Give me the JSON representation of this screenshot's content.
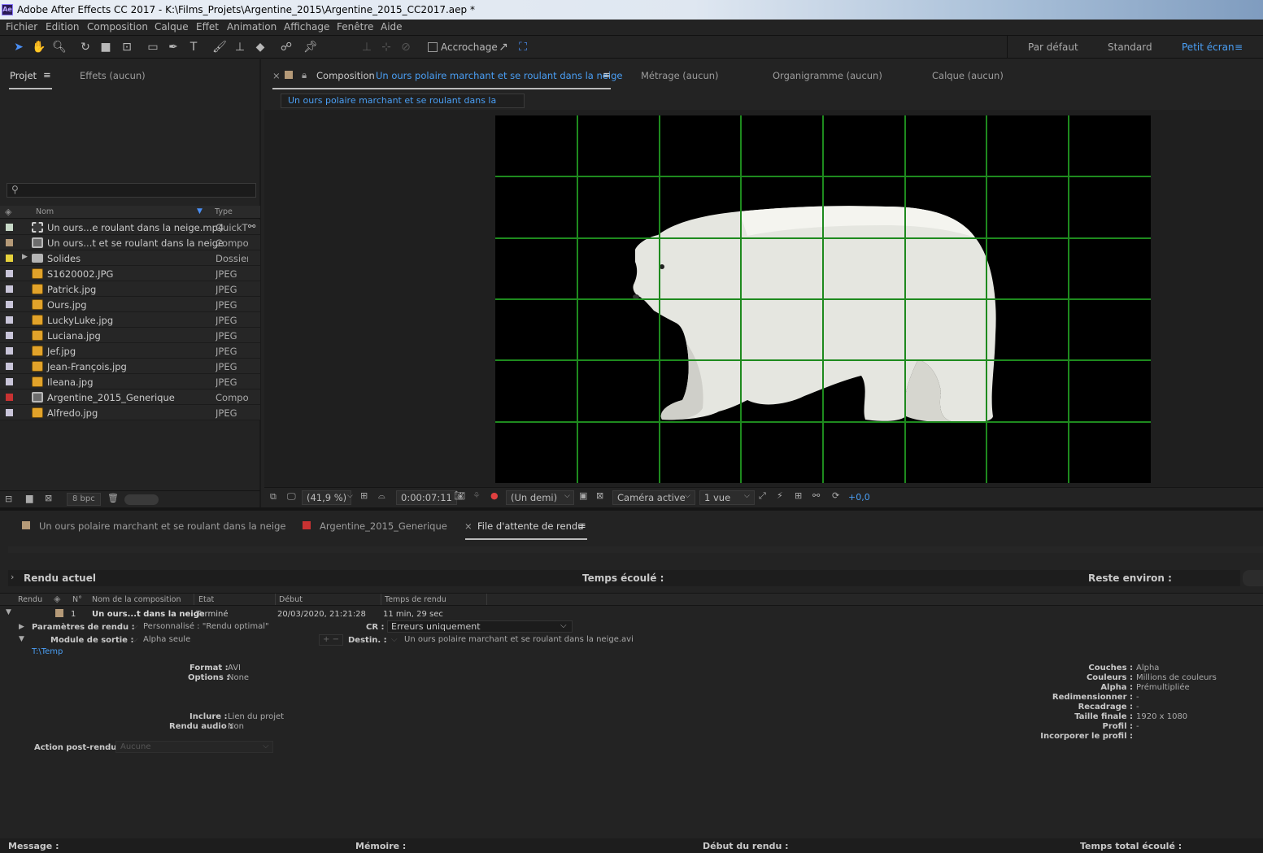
{
  "window": {
    "title": "Adobe After Effects CC 2017 - K:\\Films_Projets\\Argentine_2015\\Argentine_2015_CC2017.aep *",
    "app_icon": "Ae"
  },
  "menu": [
    "Fichier",
    "Edition",
    "Composition",
    "Calque",
    "Effet",
    "Animation",
    "Affichage",
    "Fenêtre",
    "Aide"
  ],
  "toolbar": {
    "snap_label": "Accrochage"
  },
  "workspaces": [
    "Par défaut",
    "Standard",
    "Petit écran"
  ],
  "project_panel": {
    "tabs": [
      "Projet",
      "Effets (aucun)"
    ],
    "search_placeholder": "",
    "col_name": "Nom",
    "col_type": "Type",
    "items": [
      {
        "name": "Un ours...e roulant dans la neige.mp4",
        "type": "QuickTi",
        "color": "#c8d9c8",
        "icon": "footage-icon"
      },
      {
        "name": "Un ours...t et se roulant dans la neige",
        "type": "Compo",
        "color": "#b59a78",
        "icon": "composition-icon"
      },
      {
        "name": "Solides",
        "type": "Dossier",
        "color": "#e6d23c",
        "icon": "folder-icon"
      },
      {
        "name": "S1620002.JPG",
        "type": "JPEG",
        "color": "#c9c5d9",
        "icon": "image-icon"
      },
      {
        "name": "Patrick.jpg",
        "type": "JPEG",
        "color": "#c9c5d9",
        "icon": "image-icon"
      },
      {
        "name": "Ours.jpg",
        "type": "JPEG",
        "color": "#c9c5d9",
        "icon": "image-icon"
      },
      {
        "name": "LuckyLuke.jpg",
        "type": "JPEG",
        "color": "#c9c5d9",
        "icon": "image-icon"
      },
      {
        "name": "Luciana.jpg",
        "type": "JPEG",
        "color": "#c9c5d9",
        "icon": "image-icon"
      },
      {
        "name": "Jef.jpg",
        "type": "JPEG",
        "color": "#c9c5d9",
        "icon": "image-icon"
      },
      {
        "name": "Jean-François.jpg",
        "type": "JPEG",
        "color": "#c9c5d9",
        "icon": "image-icon"
      },
      {
        "name": "Ileana.jpg",
        "type": "JPEG",
        "color": "#c9c5d9",
        "icon": "image-icon"
      },
      {
        "name": "Argentine_2015_Generique",
        "type": "Compo",
        "color": "#c83232",
        "icon": "composition-icon"
      },
      {
        "name": "Alfredo.jpg",
        "type": "JPEG",
        "color": "#c9c5d9",
        "icon": "image-icon"
      }
    ],
    "bpc": "8 bpc"
  },
  "composition_panel": {
    "tab_prefix": "Composition",
    "tab_name": "Un ours polaire marchant et se roulant dans la neige",
    "other_tabs": [
      "Métrage (aucun)",
      "Organigramme (aucun)",
      "Calque (aucun)"
    ],
    "breadcrumb": "Un ours polaire marchant et se roulant dans la neige",
    "zoom": "(41,9 %)",
    "timecode": "0:00:07:11",
    "resolution": "(Un demi)",
    "camera": "Caméra active",
    "views": "1 vue",
    "exposure": "+0,0"
  },
  "timeline_tabs": [
    {
      "label": "Un ours polaire marchant et se roulant dans la neige",
      "color": "#b59a78"
    },
    {
      "label": "Argentine_2015_Generique",
      "color": "#c83232"
    },
    {
      "label": "File d'attente de rendu",
      "color": ""
    }
  ],
  "render_queue": {
    "current_render": "Rendu actuel",
    "elapsed": "Temps écoulé :",
    "remaining": "Reste environ :",
    "columns": [
      "Rendu",
      "N°",
      "Nom de la composition",
      "Etat",
      "Début",
      "Temps de rendu"
    ],
    "item": {
      "num": "1",
      "comp": "Un ours...t dans la neige",
      "status": "Terminé",
      "start": "20/03/2020, 21:21:28",
      "duration": "11 min, 29 sec"
    },
    "render_settings_label": "Paramètres de rendu :",
    "render_settings_value": "Personnalisé : \"Rendu optimal\"",
    "cr_label": "CR :",
    "cr_value": "Erreurs uniquement",
    "output_module_label": "Module de sortie :",
    "output_module_value": "Alpha seule",
    "dest_label": "Destin. :",
    "dest_value": "Un ours polaire marchant et se roulant dans la neige.avi",
    "path": "T:\\Temp",
    "format_label": "Format :",
    "format_value": "AVI",
    "options_label": "Options :",
    "options_value": "None",
    "include_label": "Inclure :",
    "include_value": "Lien du projet",
    "audio_label": "Rendu audio :",
    "audio_value": "Non",
    "post_label": "Action post-rendu :",
    "post_value": "Aucune",
    "right_details": [
      {
        "label": "Couches :",
        "value": "Alpha"
      },
      {
        "label": "Couleurs :",
        "value": "Millions de couleurs"
      },
      {
        "label": "Alpha :",
        "value": "Prémultipliée"
      },
      {
        "label": "Redimensionner :",
        "value": "-"
      },
      {
        "label": "Recadrage :",
        "value": "-"
      },
      {
        "label": "Taille finale :",
        "value": "1920 x 1080"
      },
      {
        "label": "Profil :",
        "value": "-"
      },
      {
        "label": "Incorporer le profil :",
        "value": ""
      }
    ]
  },
  "status_bar": {
    "message": "Message :",
    "memory": "Mémoire :",
    "render_start": "Début du rendu :",
    "total_time": "Temps total écoulé :"
  }
}
